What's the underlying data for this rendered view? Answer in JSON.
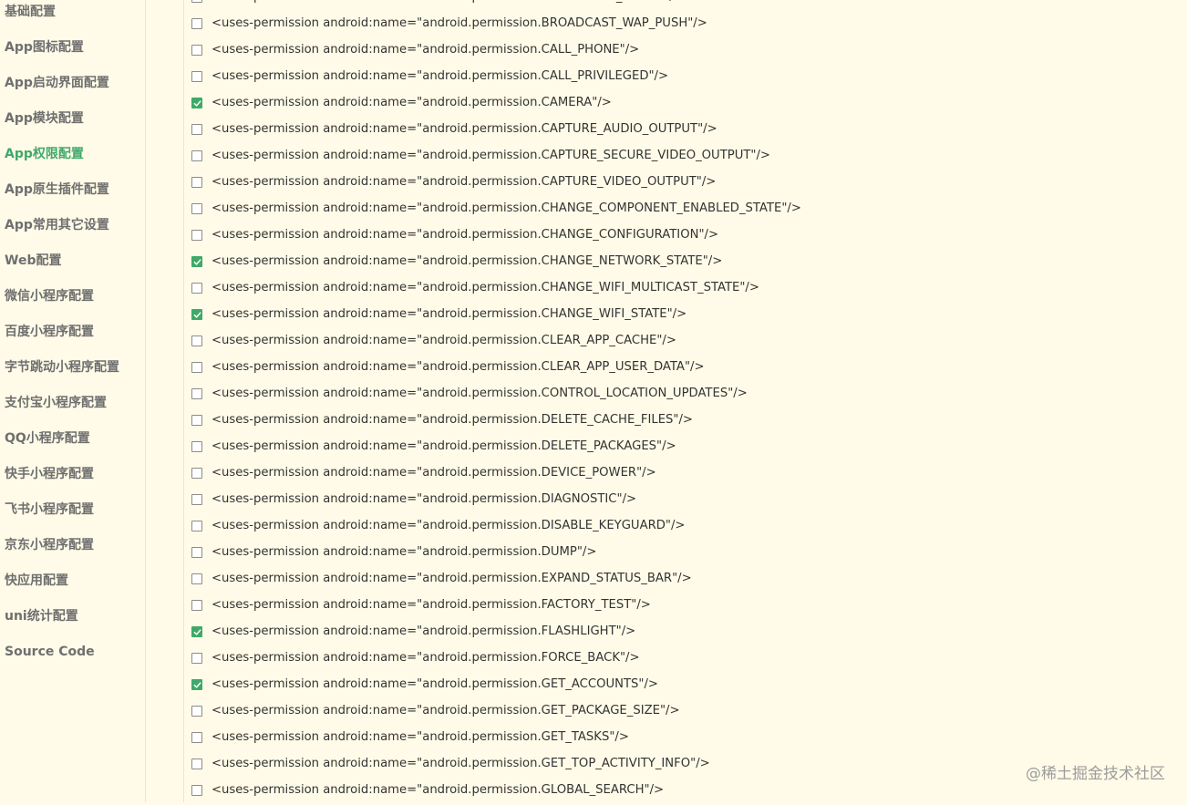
{
  "colors": {
    "background": "#fffbe8",
    "active": "#3fa96a",
    "sidebar_text": "#6f6f6f",
    "checkbox_checked": "#3fa96a"
  },
  "sidebar": {
    "active_index": 4,
    "items": [
      {
        "label": "基础配置"
      },
      {
        "label": "App图标配置"
      },
      {
        "label": "App启动界面配置"
      },
      {
        "label": "App模块配置"
      },
      {
        "label": "App权限配置"
      },
      {
        "label": "App原生插件配置"
      },
      {
        "label": "App常用其它设置"
      },
      {
        "label": "Web配置"
      },
      {
        "label": "微信小程序配置"
      },
      {
        "label": "百度小程序配置"
      },
      {
        "label": "字节跳动小程序配置"
      },
      {
        "label": "支付宝小程序配置"
      },
      {
        "label": "QQ小程序配置"
      },
      {
        "label": "快手小程序配置"
      },
      {
        "label": "飞书小程序配置"
      },
      {
        "label": "京东小程序配置"
      },
      {
        "label": "快应用配置"
      },
      {
        "label": "uni统计配置"
      },
      {
        "label": "Source Code"
      }
    ]
  },
  "permissions": [
    {
      "text": "<uses-permission android:name=\"android.permission.BROADCAST_STICKY\"/>",
      "checked": false
    },
    {
      "text": "<uses-permission android:name=\"android.permission.BROADCAST_WAP_PUSH\"/>",
      "checked": false
    },
    {
      "text": "<uses-permission android:name=\"android.permission.CALL_PHONE\"/>",
      "checked": false
    },
    {
      "text": "<uses-permission android:name=\"android.permission.CALL_PRIVILEGED\"/>",
      "checked": false
    },
    {
      "text": "<uses-permission android:name=\"android.permission.CAMERA\"/>",
      "checked": true
    },
    {
      "text": "<uses-permission android:name=\"android.permission.CAPTURE_AUDIO_OUTPUT\"/>",
      "checked": false
    },
    {
      "text": "<uses-permission android:name=\"android.permission.CAPTURE_SECURE_VIDEO_OUTPUT\"/>",
      "checked": false
    },
    {
      "text": "<uses-permission android:name=\"android.permission.CAPTURE_VIDEO_OUTPUT\"/>",
      "checked": false
    },
    {
      "text": "<uses-permission android:name=\"android.permission.CHANGE_COMPONENT_ENABLED_STATE\"/>",
      "checked": false
    },
    {
      "text": "<uses-permission android:name=\"android.permission.CHANGE_CONFIGURATION\"/>",
      "checked": false
    },
    {
      "text": "<uses-permission android:name=\"android.permission.CHANGE_NETWORK_STATE\"/>",
      "checked": true
    },
    {
      "text": "<uses-permission android:name=\"android.permission.CHANGE_WIFI_MULTICAST_STATE\"/>",
      "checked": false
    },
    {
      "text": "<uses-permission android:name=\"android.permission.CHANGE_WIFI_STATE\"/>",
      "checked": true
    },
    {
      "text": "<uses-permission android:name=\"android.permission.CLEAR_APP_CACHE\"/>",
      "checked": false
    },
    {
      "text": "<uses-permission android:name=\"android.permission.CLEAR_APP_USER_DATA\"/>",
      "checked": false
    },
    {
      "text": "<uses-permission android:name=\"android.permission.CONTROL_LOCATION_UPDATES\"/>",
      "checked": false
    },
    {
      "text": "<uses-permission android:name=\"android.permission.DELETE_CACHE_FILES\"/>",
      "checked": false
    },
    {
      "text": "<uses-permission android:name=\"android.permission.DELETE_PACKAGES\"/>",
      "checked": false
    },
    {
      "text": "<uses-permission android:name=\"android.permission.DEVICE_POWER\"/>",
      "checked": false
    },
    {
      "text": "<uses-permission android:name=\"android.permission.DIAGNOSTIC\"/>",
      "checked": false
    },
    {
      "text": "<uses-permission android:name=\"android.permission.DISABLE_KEYGUARD\"/>",
      "checked": false
    },
    {
      "text": "<uses-permission android:name=\"android.permission.DUMP\"/>",
      "checked": false
    },
    {
      "text": "<uses-permission android:name=\"android.permission.EXPAND_STATUS_BAR\"/>",
      "checked": false
    },
    {
      "text": "<uses-permission android:name=\"android.permission.FACTORY_TEST\"/>",
      "checked": false
    },
    {
      "text": "<uses-permission android:name=\"android.permission.FLASHLIGHT\"/>",
      "checked": true
    },
    {
      "text": "<uses-permission android:name=\"android.permission.FORCE_BACK\"/>",
      "checked": false
    },
    {
      "text": "<uses-permission android:name=\"android.permission.GET_ACCOUNTS\"/>",
      "checked": true
    },
    {
      "text": "<uses-permission android:name=\"android.permission.GET_PACKAGE_SIZE\"/>",
      "checked": false
    },
    {
      "text": "<uses-permission android:name=\"android.permission.GET_TASKS\"/>",
      "checked": false
    },
    {
      "text": "<uses-permission android:name=\"android.permission.GET_TOP_ACTIVITY_INFO\"/>",
      "checked": false
    },
    {
      "text": "<uses-permission android:name=\"android.permission.GLOBAL_SEARCH\"/>",
      "checked": false
    }
  ],
  "watermark": "@稀土掘金技术社区"
}
